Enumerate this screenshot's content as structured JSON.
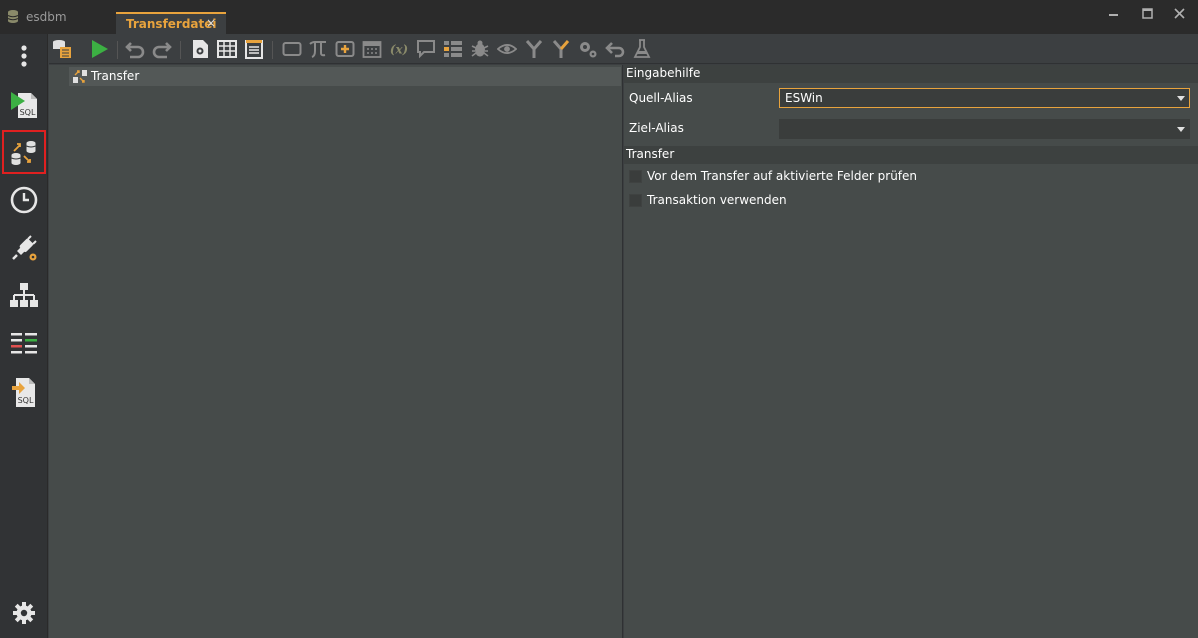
{
  "app": {
    "name": "esdbm"
  },
  "tab": {
    "label": "Transferdatei",
    "close_glyph": "×"
  },
  "window_controls": [
    "minimize-icon",
    "maximize-icon",
    "close-icon"
  ],
  "sidebar": {
    "items": [
      {
        "icon": "more-vertical-icon"
      },
      {
        "icon": "sql-script-run-icon",
        "text": "SQL"
      },
      {
        "icon": "data-transfer-icon",
        "selected": true
      },
      {
        "icon": "clock-icon"
      },
      {
        "icon": "plugin-settings-icon"
      },
      {
        "icon": "hierarchy-icon"
      },
      {
        "icon": "compare-lines-icon"
      },
      {
        "icon": "sql-import-icon",
        "text": "SQL"
      },
      {
        "icon": "settings-gear-icon"
      }
    ]
  },
  "toolbar": {
    "icons": [
      "database-file-icon",
      "run-icon",
      "undo-icon",
      "redo-icon",
      "file-settings-icon",
      "table-grid-icon",
      "notepad-icon",
      "rectangle-icon",
      "pi-icon",
      "plus-box-icon",
      "calendar-icon",
      "function-icon",
      "comment-icon",
      "list-icon",
      "bug-icon",
      "eye-icon",
      "branch-icon",
      "branch-alt-icon",
      "gears-icon",
      "return-icon",
      "flask-icon"
    ]
  },
  "tree": {
    "items": [
      {
        "label": "Transfer",
        "icon": "data-transfer-icon"
      }
    ]
  },
  "properties": {
    "sections": {
      "input_help": "Eingabehilfe",
      "transfer": "Transfer"
    },
    "source_alias": {
      "label": "Quell-Alias",
      "value": "ESWin"
    },
    "target_alias": {
      "label": "Ziel-Alias",
      "value": ""
    },
    "checkboxes": [
      {
        "label": "Vor dem Transfer auf aktivierte Felder prüfen",
        "checked": false
      },
      {
        "label": "Transaktion verwenden",
        "checked": false
      }
    ]
  },
  "colors": {
    "accent": "#e8a33d",
    "selection_border": "#e02020",
    "run_green": "#3cb043"
  }
}
